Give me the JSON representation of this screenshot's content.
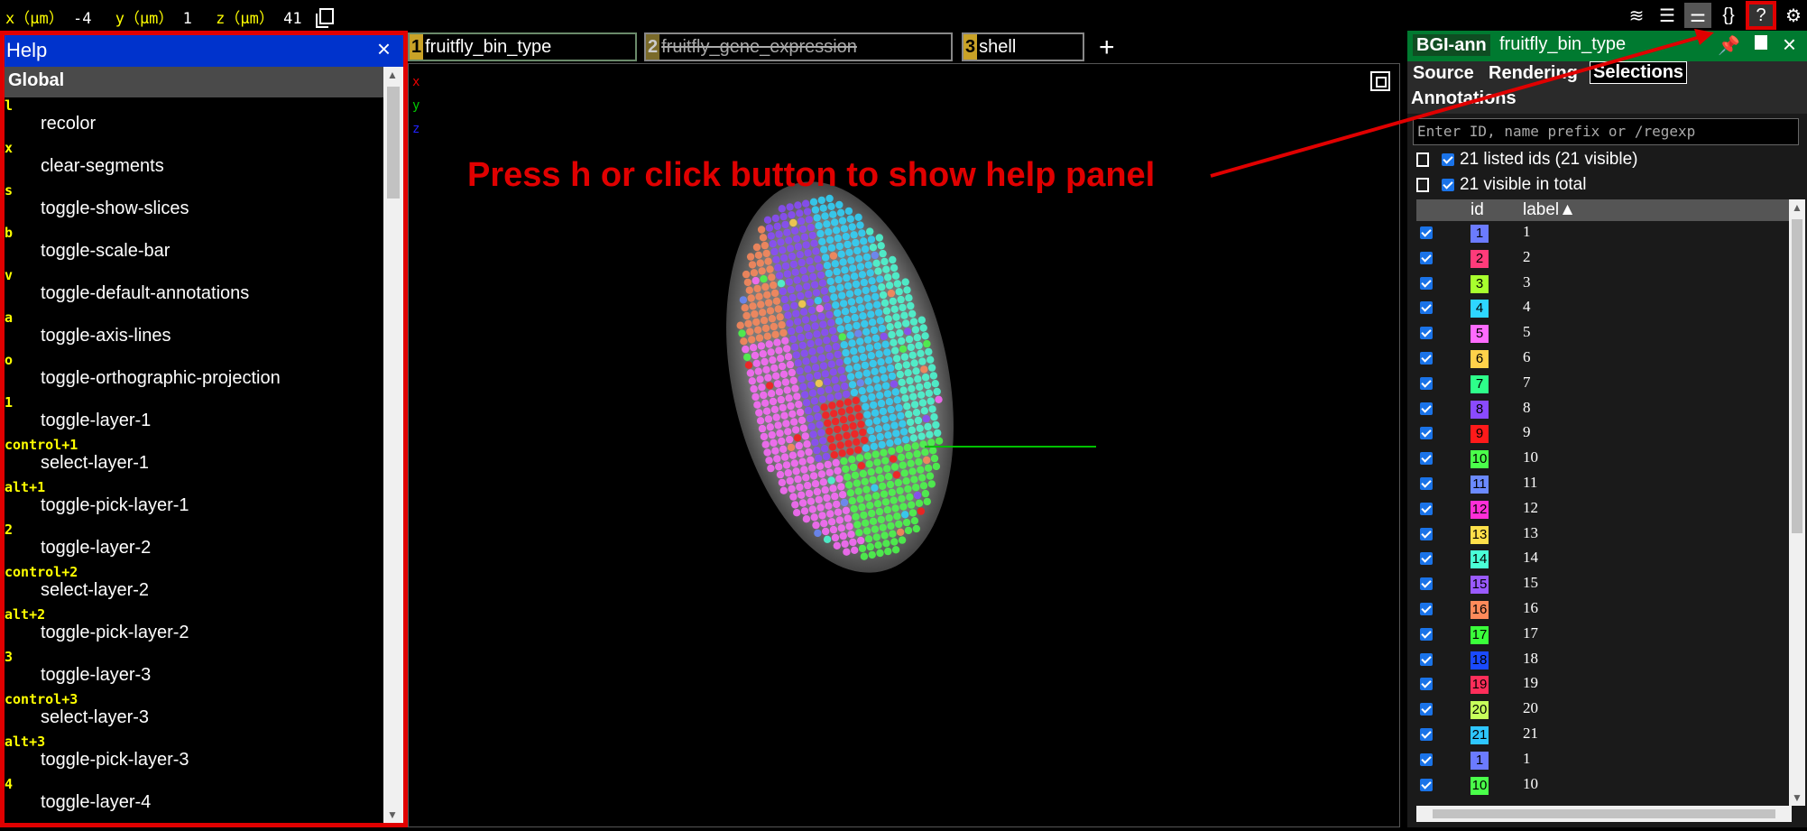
{
  "coords": {
    "x_label": "x（μm）",
    "x_value": "-4",
    "y_label": "y（μm）",
    "y_value": "1",
    "z_label": "z（μm）",
    "z_value": "41"
  },
  "top_icons": [
    "layers-icon",
    "list-icon",
    "settings-sliders-icon",
    "json-braces-icon",
    "help-question-icon",
    "gear-icon"
  ],
  "top_icon_glyphs": [
    "≋",
    "☰",
    "⚌",
    "{}",
    "?",
    "⚙"
  ],
  "help": {
    "title": "Help",
    "close": "×",
    "section": "Global",
    "bindings": [
      {
        "key": "l",
        "action": "recolor"
      },
      {
        "key": "x",
        "action": "clear-segments"
      },
      {
        "key": "s",
        "action": "toggle-show-slices"
      },
      {
        "key": "b",
        "action": "toggle-scale-bar"
      },
      {
        "key": "v",
        "action": "toggle-default-annotations"
      },
      {
        "key": "a",
        "action": "toggle-axis-lines"
      },
      {
        "key": "o",
        "action": "toggle-orthographic-projection"
      },
      {
        "key": "1",
        "action": "toggle-layer-1"
      },
      {
        "key": "control+1",
        "action": "select-layer-1"
      },
      {
        "key": "alt+1",
        "action": "toggle-pick-layer-1"
      },
      {
        "key": "2",
        "action": "toggle-layer-2"
      },
      {
        "key": "control+2",
        "action": "select-layer-2"
      },
      {
        "key": "alt+2",
        "action": "toggle-pick-layer-2"
      },
      {
        "key": "3",
        "action": "toggle-layer-3"
      },
      {
        "key": "control+3",
        "action": "select-layer-3"
      },
      {
        "key": "alt+3",
        "action": "toggle-pick-layer-3"
      },
      {
        "key": "4",
        "action": "toggle-layer-4"
      }
    ]
  },
  "tabs": [
    {
      "num": "1",
      "name": "fruitfly_bin_type",
      "strikethrough": false
    },
    {
      "num": "2",
      "name": "fruitfly_gene_expression",
      "strikethrough": true
    },
    {
      "num": "3",
      "name": "shell",
      "strikethrough": false
    }
  ],
  "add_tab": "+",
  "viewer": {
    "axis_x": "x",
    "axis_y": "y",
    "axis_z": "z",
    "annotation": "Press h or click button to show help panel"
  },
  "side_panel": {
    "layer_name": "BGI-ann",
    "source_name": "fruitfly_bin_type",
    "close": "×",
    "tabs": [
      "Source",
      "Rendering",
      "Selections",
      "Annotations"
    ],
    "selected_tab": "Selections",
    "filter_placeholder": "Enter ID, name prefix or /regexp",
    "listed_summary": "21 listed ids (21 visible)",
    "visible_summary": "21 visible in total",
    "col_id": "id",
    "col_label": "label▲",
    "rows": [
      {
        "id": "1",
        "label": "1",
        "color": "#6b7bff"
      },
      {
        "id": "2",
        "label": "2",
        "color": "#ff3b7a"
      },
      {
        "id": "3",
        "label": "3",
        "color": "#a8ff2e"
      },
      {
        "id": "4",
        "label": "4",
        "color": "#2ed6ff"
      },
      {
        "id": "5",
        "label": "5",
        "color": "#ff6bff"
      },
      {
        "id": "6",
        "label": "6",
        "color": "#ffd24a"
      },
      {
        "id": "7",
        "label": "7",
        "color": "#2eff8a"
      },
      {
        "id": "8",
        "label": "8",
        "color": "#8a4aff"
      },
      {
        "id": "9",
        "label": "9",
        "color": "#ff1a1a"
      },
      {
        "id": "10",
        "label": "10",
        "color": "#4aff4a"
      },
      {
        "id": "11",
        "label": "11",
        "color": "#6b8aff"
      },
      {
        "id": "12",
        "label": "12",
        "color": "#ff2ed6"
      },
      {
        "id": "13",
        "label": "13",
        "color": "#ffe04a"
      },
      {
        "id": "14",
        "label": "14",
        "color": "#4affd6"
      },
      {
        "id": "15",
        "label": "15",
        "color": "#9a5aff"
      },
      {
        "id": "16",
        "label": "16",
        "color": "#ff8a5a"
      },
      {
        "id": "17",
        "label": "17",
        "color": "#3aff3a"
      },
      {
        "id": "18",
        "label": "18",
        "color": "#1a4aff"
      },
      {
        "id": "19",
        "label": "19",
        "color": "#ff2e5a"
      },
      {
        "id": "20",
        "label": "20",
        "color": "#c6ff5a"
      },
      {
        "id": "21",
        "label": "21",
        "color": "#2ec6ff"
      },
      {
        "id": "1",
        "label": "1",
        "color": "#6b7bff"
      },
      {
        "id": "10",
        "label": "10",
        "color": "#4aff4a"
      }
    ]
  },
  "accent_colors": {
    "highlight": "#e00000",
    "help_header": "#0033cc",
    "panel_header": "#007a30"
  }
}
